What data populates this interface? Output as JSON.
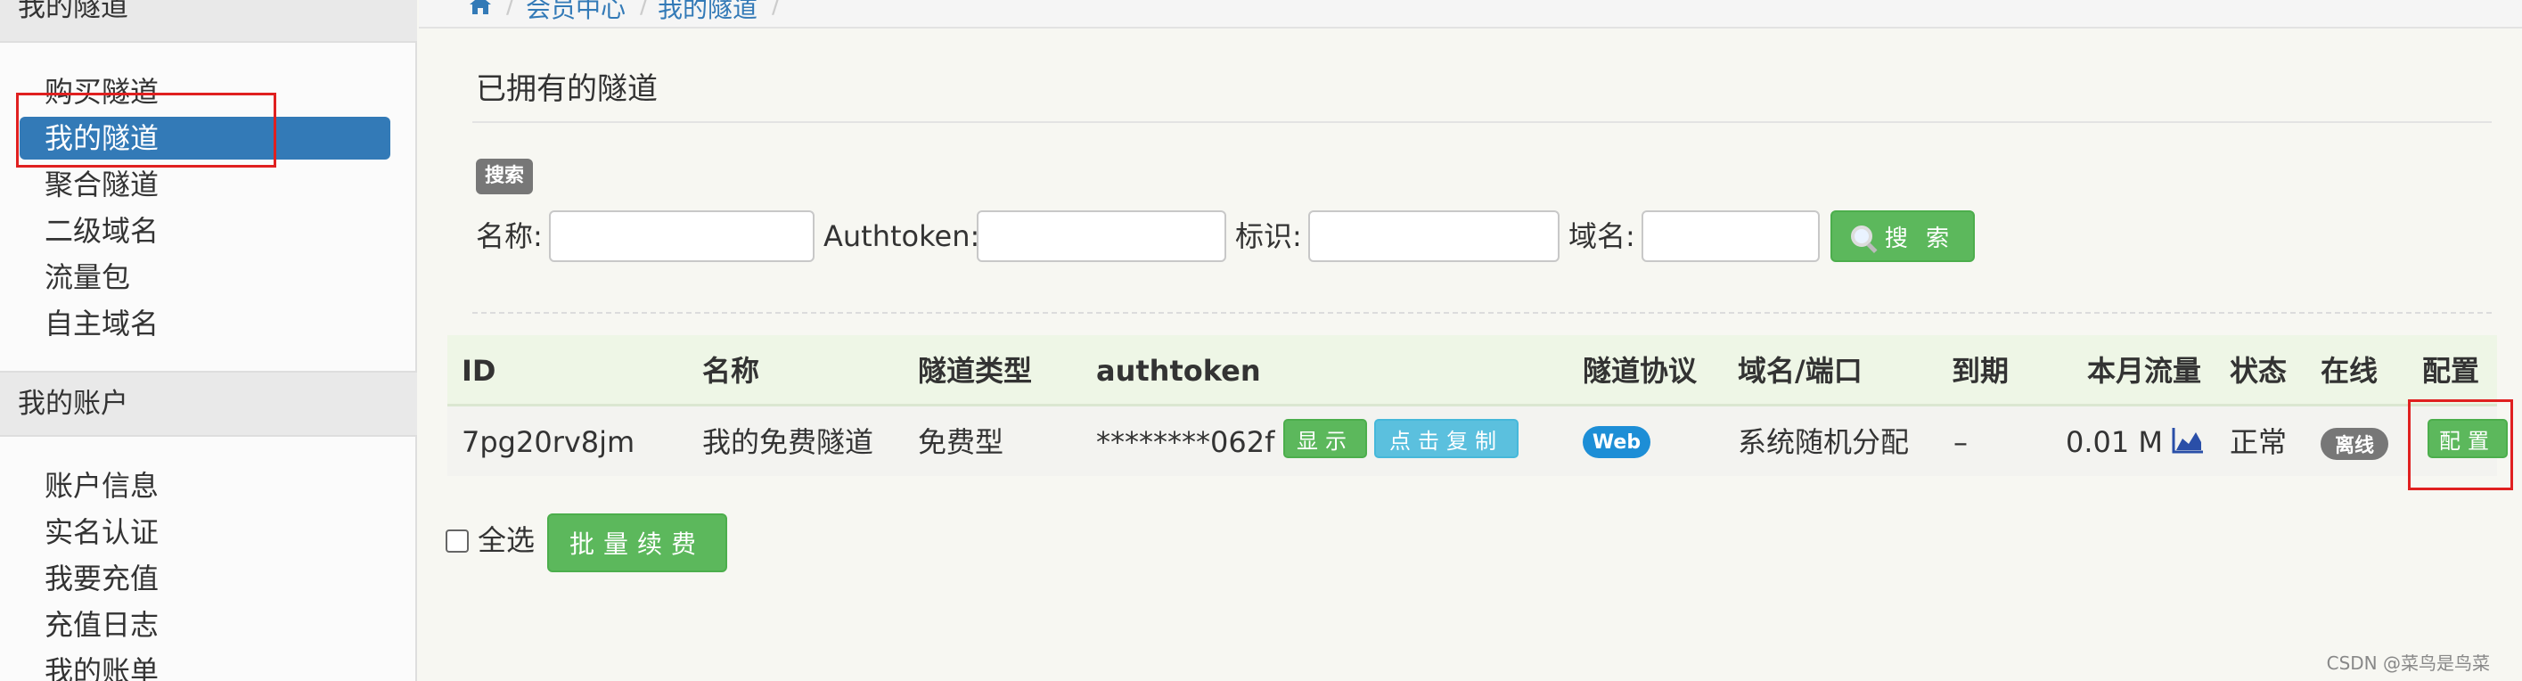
{
  "sidebar": {
    "sections": [
      {
        "title": "我的隧道",
        "items": [
          "购买隧道",
          "我的隧道",
          "聚合隧道",
          "二级域名",
          "流量包",
          "自主域名"
        ]
      },
      {
        "title": "我的账户",
        "items": [
          "账户信息",
          "实名认证",
          "我要充值",
          "充值日志",
          "我的账单"
        ]
      }
    ],
    "active_item": "我的隧道"
  },
  "breadcrumb": {
    "items": [
      "会员中心",
      "我的隧道"
    ]
  },
  "page": {
    "title": "已拥有的隧道"
  },
  "search": {
    "badge": "搜索",
    "fields": [
      {
        "label": "名称:",
        "value": ""
      },
      {
        "label": "Authtoken:",
        "value": ""
      },
      {
        "label": "标识:",
        "value": ""
      },
      {
        "label": "域名:",
        "value": ""
      }
    ],
    "button_label": "搜 索"
  },
  "table": {
    "columns": [
      "ID",
      "名称",
      "隧道类型",
      "authtoken",
      "隧道协议",
      "域名/端口",
      "到期",
      "本月流量",
      "状态",
      "在线",
      "配置"
    ],
    "rows": [
      {
        "id": "7pg20rv8jm",
        "name": "我的免费隧道",
        "type": "免费型",
        "authtoken": "********062f",
        "show_button": "显示",
        "copy_button": "点击复制",
        "protocol": "Web",
        "domain": "系统随机分配",
        "expire": "–",
        "traffic": "0.01 M",
        "status": "正常",
        "online": "离线",
        "config_button": "配置"
      }
    ]
  },
  "footer": {
    "select_all": "全选",
    "batch_button": "批量续费"
  },
  "watermark": "CSDN @菜鸟是鸟菜",
  "colors": {
    "primary": "#337ab7",
    "success": "#5cb85c",
    "info": "#5bc0de",
    "highlight": "#e02020",
    "badge_web": "#1d8ed6"
  }
}
